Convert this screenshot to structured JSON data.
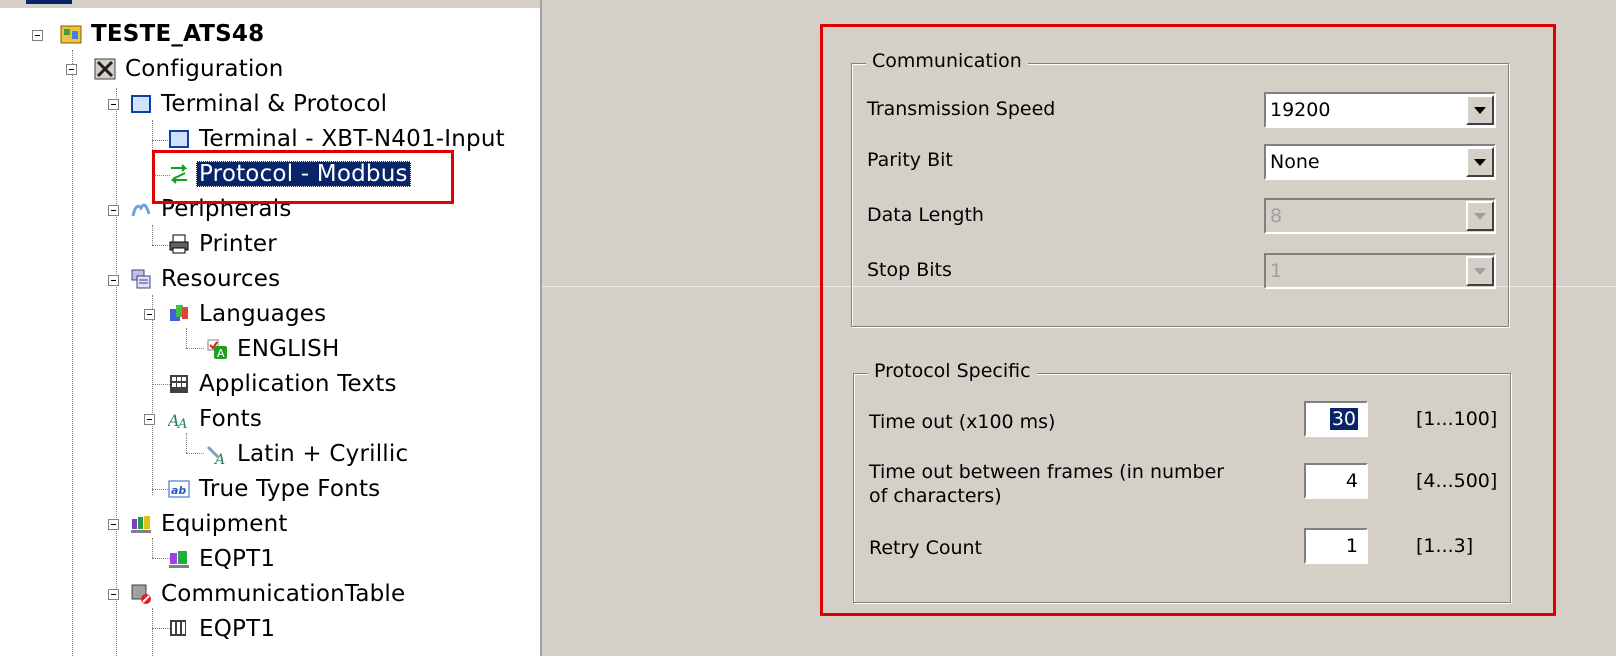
{
  "tree": {
    "root": "TESTE_ATS48",
    "configuration": "Configuration",
    "terminal_protocol": "Terminal & Protocol",
    "terminal": "Terminal - XBT-N401-Input",
    "protocol": "Protocol - Modbus",
    "peripherals": "Peripherals",
    "printer": "Printer",
    "resources": "Resources",
    "languages": "Languages",
    "english": "ENGLISH",
    "application_texts": "Application Texts",
    "fonts": "Fonts",
    "latin_cyrillic": "Latin + Cyrillic",
    "true_type_fonts": "True Type Fonts",
    "equipment": "Equipment",
    "eqpt1": "EQPT1",
    "communication_table": "CommunicationTable",
    "comm_eqpt1": "EQPT1"
  },
  "communication": {
    "title": "Communication",
    "transmission_speed_label": "Transmission Speed",
    "transmission_speed_value": "19200",
    "parity_bit_label": "Parity Bit",
    "parity_bit_value": "None",
    "data_length_label": "Data Length",
    "data_length_value": "8",
    "stop_bits_label": "Stop Bits",
    "stop_bits_value": "1"
  },
  "protocol_specific": {
    "title": "Protocol Specific",
    "timeout_label": "Time out (x100 ms)",
    "timeout_value": "30",
    "timeout_range": "[1...100]",
    "timeout_frames_label_line1": "Time out between frames (in number",
    "timeout_frames_label_line2": "of characters)",
    "timeout_frames_value": "4",
    "timeout_frames_range": "[4...500]",
    "retry_label": "Retry Count",
    "retry_value": "1",
    "retry_range": "[1...3]"
  },
  "colors": {
    "highlight_frame": "#e00000",
    "selection": "#0a246a",
    "panel_bg": "#d4d0c8"
  }
}
